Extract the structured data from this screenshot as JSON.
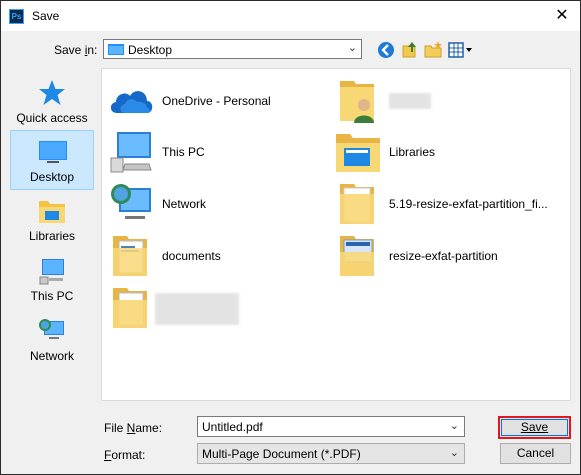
{
  "titlebar": {
    "app_icon_text": "Ps",
    "title": "Save",
    "close_glyph": "✕"
  },
  "savein": {
    "label_pre": "Save ",
    "label_accel": "i",
    "label_post": "n:",
    "location": "Desktop"
  },
  "places": [
    {
      "label": "Quick access",
      "icon": "star-icon"
    },
    {
      "label": "Desktop",
      "icon": "desktop-icon",
      "selected": true
    },
    {
      "label": "Libraries",
      "icon": "libraries-icon"
    },
    {
      "label": "This PC",
      "icon": "computer-icon"
    },
    {
      "label": "Network",
      "icon": "network-icon"
    }
  ],
  "items": [
    {
      "label": "OneDrive - Personal",
      "icon": "onedrive-icon"
    },
    {
      "label": "",
      "icon": "user-folder-icon"
    },
    {
      "label": "This PC",
      "icon": "computer-icon"
    },
    {
      "label": "Libraries",
      "icon": "libraries-icon"
    },
    {
      "label": "Network",
      "icon": "network-icon"
    },
    {
      "label": "5.19-resize-exfat-partition_fi...",
      "icon": "folder-icon"
    },
    {
      "label": "documents",
      "icon": "folder-icon"
    },
    {
      "label": "resize-exfat-partition",
      "icon": "folder-icon"
    },
    {
      "label": "",
      "icon": "folder-icon"
    }
  ],
  "filename": {
    "label_accel": "N",
    "label_pre": "File ",
    "label_post": "ame:",
    "value": "Untitled.pdf"
  },
  "format": {
    "label_accel": "F",
    "label_post": "ormat:",
    "value": "Multi-Page Document (*.PDF)"
  },
  "buttons": {
    "save": "Save",
    "cancel": "Cancel"
  },
  "colors": {
    "accent": "#0078d7",
    "highlight": "#e0191f",
    "selection": "#cce8ff",
    "folder": "#f8d775"
  }
}
